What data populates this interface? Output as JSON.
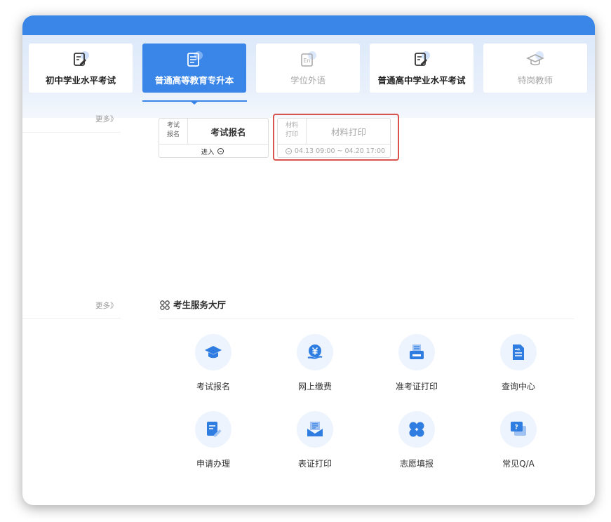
{
  "tabs": [
    {
      "label": "初中学业水平考试",
      "icon": "edit-doc-icon",
      "state": "normal"
    },
    {
      "label": "普通高等教育专升本",
      "icon": "news-doc-icon",
      "state": "active"
    },
    {
      "label": "学位外语",
      "icon": "english-icon",
      "state": "disabled"
    },
    {
      "label": "普通高中学业水平考试",
      "icon": "edit-doc-icon",
      "state": "normal"
    },
    {
      "label": "特岗教师",
      "icon": "graduation-cap-icon",
      "state": "disabled"
    }
  ],
  "more_label": "更多》",
  "entries": {
    "registration": {
      "side_line1": "考试",
      "side_line2": "报名",
      "title": "考试报名",
      "action": "进入"
    },
    "material": {
      "side_line1": "材料",
      "side_line2": "打印",
      "title": "材料打印",
      "period": "04.13 09:00 ~ 04.20 17:00"
    }
  },
  "services": {
    "title": "考生服务大厅",
    "items": [
      {
        "label": "考试报名",
        "icon": "graduation-cap-icon"
      },
      {
        "label": "网上缴费",
        "icon": "yuan-payment-icon"
      },
      {
        "label": "准考证打印",
        "icon": "printer-icon"
      },
      {
        "label": "查询中心",
        "icon": "search-doc-icon"
      },
      {
        "label": "申请办理",
        "icon": "edit-form-icon"
      },
      {
        "label": "表证打印",
        "icon": "certificate-print-icon"
      },
      {
        "label": "志愿填报",
        "icon": "clover-icon"
      },
      {
        "label": "常见Q/A",
        "icon": "question-chat-icon"
      }
    ]
  },
  "colors": {
    "primary": "#3a86e8",
    "highlight": "#d9534f",
    "disabled_text": "#a7a7a7"
  }
}
